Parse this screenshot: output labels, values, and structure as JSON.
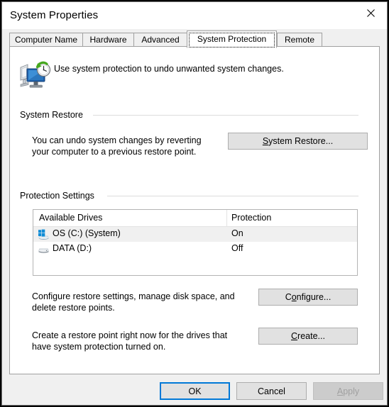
{
  "window": {
    "title": "System Properties",
    "close_icon": "close-icon"
  },
  "tabs": [
    {
      "label": "Computer Name",
      "active": false
    },
    {
      "label": "Hardware",
      "active": false
    },
    {
      "label": "Advanced",
      "active": false
    },
    {
      "label": "System Protection",
      "active": true
    },
    {
      "label": "Remote",
      "active": false
    }
  ],
  "header": {
    "icon": "system-restore-icon",
    "caption": "Use system protection to undo unwanted system changes."
  },
  "system_restore": {
    "group_label": "System Restore",
    "description_line1": "You can undo system changes by reverting",
    "description_line2": "your computer to a previous restore point.",
    "button_accel": "S",
    "button_rest": "ystem Restore..."
  },
  "protection_settings": {
    "group_label": "Protection Settings",
    "columns": [
      "Available Drives",
      "Protection"
    ],
    "drives": [
      {
        "name": "OS (C:) (System)",
        "protection": "On",
        "icon": "system-drive-icon",
        "selected": true
      },
      {
        "name": "DATA (D:)",
        "protection": "Off",
        "icon": "drive-icon",
        "selected": false
      }
    ],
    "configure_description_line1": "Configure restore settings, manage disk space, and",
    "configure_description_line2": "delete restore points.",
    "configure_button_pre": "C",
    "configure_button_accel": "o",
    "configure_button_rest": "nfigure...",
    "create_description_line1": "Create a restore point right now for the drives that",
    "create_description_line2": "have system protection turned on.",
    "create_button_accel": "C",
    "create_button_rest": "reate..."
  },
  "footer": {
    "ok_label": "OK",
    "cancel_label": "Cancel",
    "apply_accel": "A",
    "apply_rest": "pply",
    "apply_disabled": true
  },
  "colors": {
    "accent": "#0078d7",
    "dialog_bg": "#f0f0f0",
    "panel_bg": "#ffffff",
    "button_face": "#e1e1e1",
    "border": "#a0a0a0",
    "selected_row": "#f0f0f0"
  }
}
